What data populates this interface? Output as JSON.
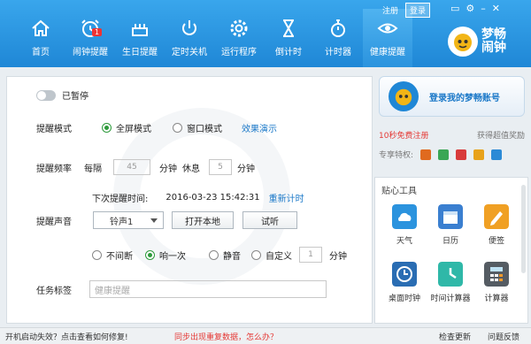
{
  "topbar": {
    "register": "注册",
    "login": "登录"
  },
  "nav": [
    {
      "label": "首页",
      "icon": "home-icon"
    },
    {
      "label": "闹钟提醒",
      "icon": "alarm-clock-icon",
      "badge": "1"
    },
    {
      "label": "生日提醒",
      "icon": "birthday-cake-icon"
    },
    {
      "label": "定时关机",
      "icon": "power-icon"
    },
    {
      "label": "运行程序",
      "icon": "gear-icon"
    },
    {
      "label": "倒计时",
      "icon": "hourglass-icon"
    },
    {
      "label": "计时器",
      "icon": "stopwatch-icon"
    },
    {
      "label": "健康提醒",
      "icon": "eye-icon",
      "active": true
    }
  ],
  "logo": {
    "text": "梦畅闹钟"
  },
  "main": {
    "pause_label": "已暂停",
    "mode_label": "提醒模式",
    "mode_fullscreen": "全屏模式",
    "mode_window": "窗口模式",
    "demo_link": "效果演示",
    "freq_label": "提醒频率",
    "every": "每隔",
    "every_value": "45",
    "minutes": "分钟",
    "rest": "休息",
    "rest_value": "5",
    "next_label": "下次提醒时间:",
    "next_time": "2016-03-23  15:42:31",
    "reset_link": "重新计时",
    "sound_label": "提醒声音",
    "sound_value": "铃声1",
    "open_local": "打开本地",
    "listen": "试听",
    "opt_continuous": "不间断",
    "opt_once": "响一次",
    "opt_mute": "静音",
    "opt_custom": "自定义",
    "custom_value": "1",
    "task_label": "任务标签",
    "task_placeholder": "健康提醒"
  },
  "account": {
    "login_text": "登录我的梦畅账号",
    "register_free": "10秒免费注册",
    "reward": "获得超值奖励",
    "privilege_label": "专享特权:"
  },
  "tools": {
    "title": "贴心工具",
    "items": [
      {
        "label": "天气",
        "icon": "weather-icon",
        "color": "#2b93de"
      },
      {
        "label": "日历",
        "icon": "calendar-icon",
        "color": "#3a7fd0"
      },
      {
        "label": "便签",
        "icon": "note-icon",
        "color": "#f0a024"
      },
      {
        "label": "桌面时钟",
        "icon": "desk-clock-icon",
        "color": "#2a6db3"
      },
      {
        "label": "时间计算器",
        "icon": "time-calc-icon",
        "color": "#2fb8a8"
      },
      {
        "label": "计算器",
        "icon": "calculator-icon",
        "color": "#555c63"
      }
    ]
  },
  "status": {
    "left": "开机启动失效？点击查看如何修复!",
    "middle": "同步出现重复数据，怎么办？",
    "update": "检查更新",
    "feedback": "问题反馈"
  }
}
